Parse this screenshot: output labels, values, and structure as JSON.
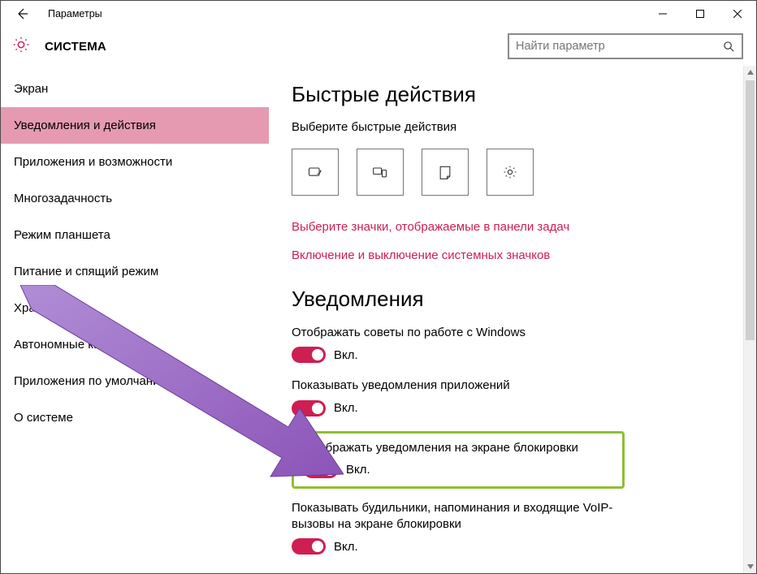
{
  "window": {
    "title": "Параметры"
  },
  "header": {
    "section": "СИСТЕМА",
    "search_placeholder": "Найти параметр"
  },
  "sidebar": {
    "items": [
      {
        "label": "Экран",
        "selected": false
      },
      {
        "label": "Уведомления и действия",
        "selected": true
      },
      {
        "label": "Приложения и возможности",
        "selected": false
      },
      {
        "label": "Многозадачность",
        "selected": false
      },
      {
        "label": "Режим планшета",
        "selected": false
      },
      {
        "label": "Питание и спящий режим",
        "selected": false
      },
      {
        "label": "Хранилище",
        "selected": false
      },
      {
        "label": "Автономные карты",
        "selected": false
      },
      {
        "label": "Приложения по умолчанию",
        "selected": false
      },
      {
        "label": "О системе",
        "selected": false
      }
    ]
  },
  "quick_actions": {
    "heading": "Быстрые действия",
    "subtitle": "Выберите быстрые действия",
    "tiles": [
      {
        "icon": "tablet-mode-icon"
      },
      {
        "icon": "connect-icon"
      },
      {
        "icon": "note-icon"
      },
      {
        "icon": "settings-icon"
      }
    ],
    "link1": "Выберите значки, отображаемые в панели задач",
    "link2": "Включение и выключение системных значков"
  },
  "notifications": {
    "heading": "Уведомления",
    "settings": [
      {
        "label": "Отображать советы по работе с Windows",
        "state": "Вкл.",
        "on": true
      },
      {
        "label": "Показывать уведомления приложений",
        "state": "Вкл.",
        "on": true
      },
      {
        "label": "Отображать уведомления на экране блокировки",
        "state": "Вкл.",
        "on": true,
        "highlighted": true
      },
      {
        "label": "Показывать будильники, напоминания и входящие VoIP-вызовы на экране блокировки",
        "state": "Вкл.",
        "on": true
      }
    ]
  },
  "colors": {
    "accent": "#cf1e52",
    "highlight_border": "#8fbf33",
    "annotation_arrow": "#9a62c5"
  }
}
